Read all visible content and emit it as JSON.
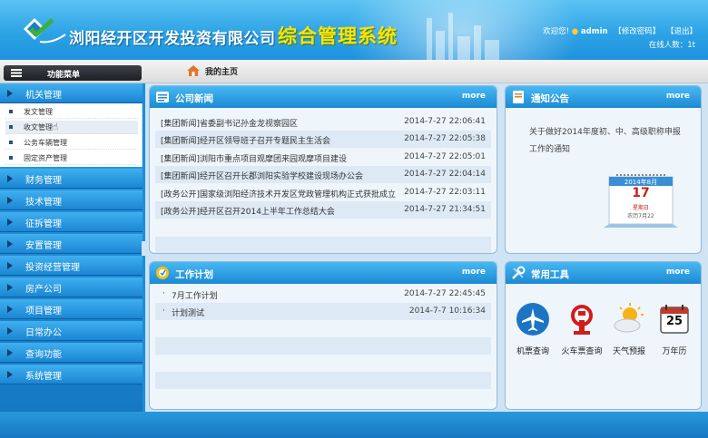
{
  "header": {
    "company": "浏阳经开区开发投资有限公司",
    "system": "综合管理系统",
    "welcome_prefix": "欢迎您!",
    "user": "admin",
    "change_pwd": "【修改密码】",
    "logout": "【退出】",
    "online_label": "在线人数：",
    "online_count": "1t"
  },
  "menu": {
    "title": "功能菜单"
  },
  "home_tab": "我的主页",
  "sidebar": {
    "expanded": "机关管理",
    "sub_items": [
      "发文管理",
      "收文管理",
      "公务车辆管理",
      "固定资产管理"
    ],
    "items": [
      "财务管理",
      "技术管理",
      "征拆管理",
      "安置管理",
      "投资经营管理",
      "房产公司",
      "项目管理",
      "日常办公",
      "查询功能",
      "系统管理"
    ]
  },
  "news": {
    "title": "公司新闻",
    "more": "more",
    "rows": [
      {
        "title": "[集团新闻]省委副书记孙金龙视察园区",
        "date": "2014-7-27  22:06:41"
      },
      {
        "title": "[集团新闻]经开区领导班子召开专题民主生活会",
        "date": "2014-7-27  22:05:38"
      },
      {
        "title": "[集团新闻]浏阳市重点项目观摩团来园观摩项目建设",
        "date": "2014-7-27  22:05:01"
      },
      {
        "title": "[集团新闻]经开区召开长郡浏阳实验学校建设现场办公会",
        "date": "2014-7-27  22:04:14"
      },
      {
        "title": "[政务公开]国家级浏阳经济技术开发区党政管理机构正式获批成立",
        "date": "2014-7-27  22:03:11"
      },
      {
        "title": "[政务公开]经开区召开2014上半年工作总结大会",
        "date": "2014-7-27  21:34:51"
      }
    ]
  },
  "notice": {
    "title": "通知公告",
    "more": "more",
    "text": "关于做好2014年度初、中、高级职称申报工作的通知",
    "calendar": {
      "month": "2014年8月",
      "day": "17",
      "weekday": "星期日",
      "lunar": "农历7月22"
    }
  },
  "plan": {
    "title": "工作计划",
    "more": "more",
    "rows": [
      {
        "title": "7月工作计划",
        "date": "2014-7-27  22:45:45"
      },
      {
        "title": "计划测试",
        "date": "2014-7-7  10:16:34"
      }
    ]
  },
  "tools": {
    "title": "常用工具",
    "more": "more",
    "items": [
      {
        "label": "机票查询",
        "icon": "airplane-icon"
      },
      {
        "label": "火车票查询",
        "icon": "train-icon"
      },
      {
        "label": "天气预报",
        "icon": "weather-icon"
      },
      {
        "label": "万年历",
        "icon": "calendar-icon"
      }
    ],
    "calendar_day": "25"
  }
}
